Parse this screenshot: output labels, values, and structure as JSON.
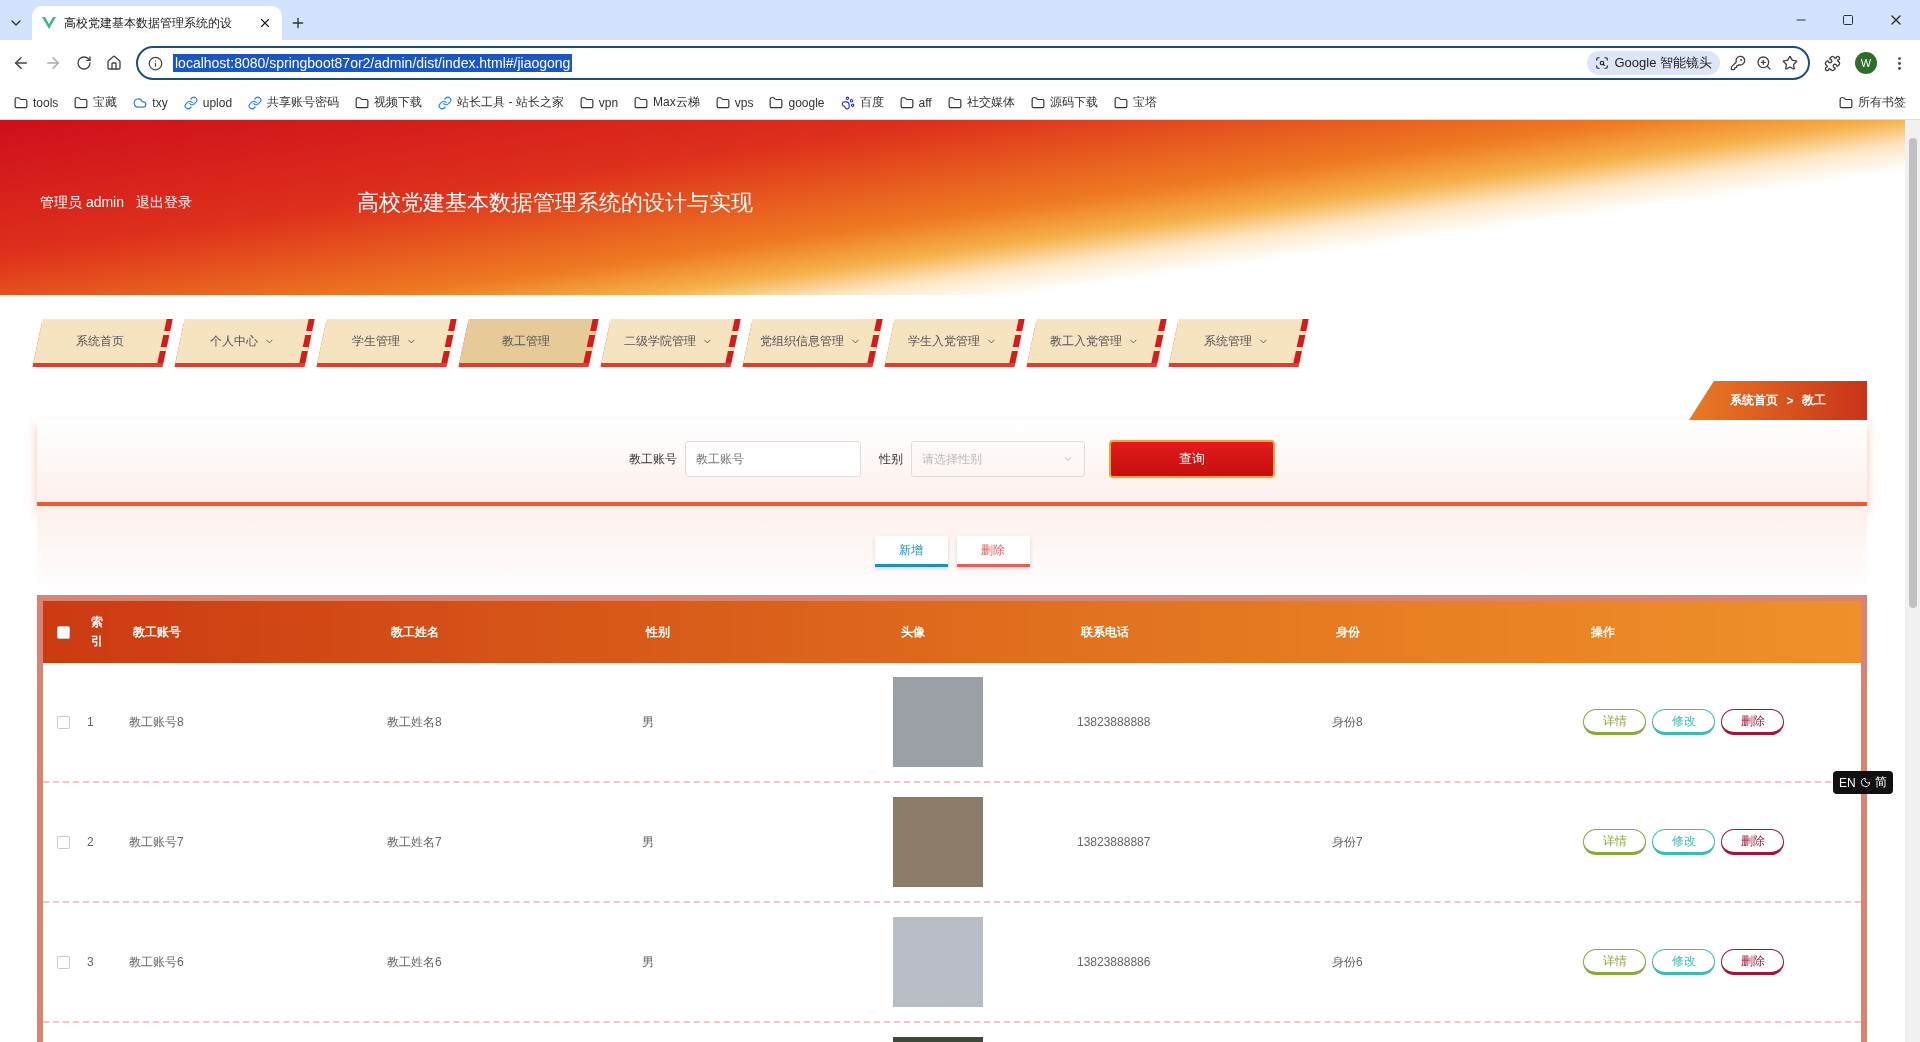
{
  "browser": {
    "tab_title": "高校党建基本数据管理系统的设",
    "url": "localhost:8080/springboot87or2/admin/dist/index.html#/jiaogong",
    "lens_label": "Google 智能镜头",
    "profile_initial": "W",
    "all_bookmarks": "所有书签",
    "bookmarks": [
      {
        "label": "tools",
        "kind": "folder"
      },
      {
        "label": "宝藏",
        "kind": "folder"
      },
      {
        "label": "txy",
        "kind": "cloud"
      },
      {
        "label": "uplod",
        "kind": "site"
      },
      {
        "label": "共享账号密码",
        "kind": "site"
      },
      {
        "label": "视频下载",
        "kind": "folder"
      },
      {
        "label": "站长工具 - 站长之家",
        "kind": "site"
      },
      {
        "label": "vpn",
        "kind": "folder"
      },
      {
        "label": "Max云梯",
        "kind": "folder"
      },
      {
        "label": "vps",
        "kind": "folder"
      },
      {
        "label": "google",
        "kind": "folder"
      },
      {
        "label": "百度",
        "kind": "paw"
      },
      {
        "label": "aff",
        "kind": "folder"
      },
      {
        "label": "社交媒体",
        "kind": "folder"
      },
      {
        "label": "源码下载",
        "kind": "folder"
      },
      {
        "label": "宝塔",
        "kind": "folder"
      }
    ]
  },
  "header": {
    "user_label": "管理员 admin",
    "logout": "退出登录",
    "title": "高校党建基本数据管理系统的设计与实现"
  },
  "nav": [
    {
      "label": "系统首页",
      "selected": false,
      "has_dropdown": false
    },
    {
      "label": "个人中心",
      "selected": false,
      "has_dropdown": true
    },
    {
      "label": "学生管理",
      "selected": false,
      "has_dropdown": true
    },
    {
      "label": "教工管理",
      "selected": true,
      "has_dropdown": false
    },
    {
      "label": "二级学院管理",
      "selected": false,
      "has_dropdown": true
    },
    {
      "label": "党组织信息管理",
      "selected": false,
      "has_dropdown": true
    },
    {
      "label": "学生入党管理",
      "selected": false,
      "has_dropdown": true
    },
    {
      "label": "教工入党管理",
      "selected": false,
      "has_dropdown": true
    },
    {
      "label": "系统管理",
      "selected": false,
      "has_dropdown": true
    }
  ],
  "breadcrumb": {
    "items": [
      "系统首页",
      "教工"
    ],
    "separator": ">"
  },
  "search": {
    "fields": [
      {
        "label": "教工账号",
        "placeholder": "教工账号",
        "kind": "input"
      },
      {
        "label": "性别",
        "placeholder": "请选择性别",
        "kind": "select"
      }
    ],
    "button": "查询"
  },
  "actions": [
    {
      "label": "新增",
      "kind": "add"
    },
    {
      "label": "删除",
      "kind": "delete"
    }
  ],
  "table": {
    "header_checked": false,
    "columns": [
      "索引",
      "教工账号",
      "教工姓名",
      "性别",
      "头像",
      "联系电话",
      "身份",
      "操作"
    ],
    "rows": [
      {
        "checked": false,
        "index": "1",
        "account": "教工账号8",
        "name": "教工姓名8",
        "gender": "男",
        "phone": "13823888888",
        "identity": "身份8",
        "actions": [
          {
            "label": "详情",
            "kind": "detail"
          },
          {
            "label": "修改",
            "kind": "edit"
          },
          {
            "label": "删除",
            "kind": "delete"
          }
        ]
      },
      {
        "checked": false,
        "index": "2",
        "account": "教工账号7",
        "name": "教工姓名7",
        "gender": "男",
        "phone": "13823888887",
        "identity": "身份7",
        "actions": [
          {
            "label": "详情",
            "kind": "detail"
          },
          {
            "label": "修改",
            "kind": "edit"
          },
          {
            "label": "删除",
            "kind": "delete"
          }
        ]
      },
      {
        "checked": false,
        "index": "3",
        "account": "教工账号6",
        "name": "教工姓名6",
        "gender": "男",
        "phone": "13823888886",
        "identity": "身份6",
        "actions": [
          {
            "label": "详情",
            "kind": "detail"
          },
          {
            "label": "修改",
            "kind": "edit"
          },
          {
            "label": "删除",
            "kind": "delete"
          }
        ]
      }
    ]
  },
  "ime": {
    "left": "EN",
    "right": "简"
  }
}
